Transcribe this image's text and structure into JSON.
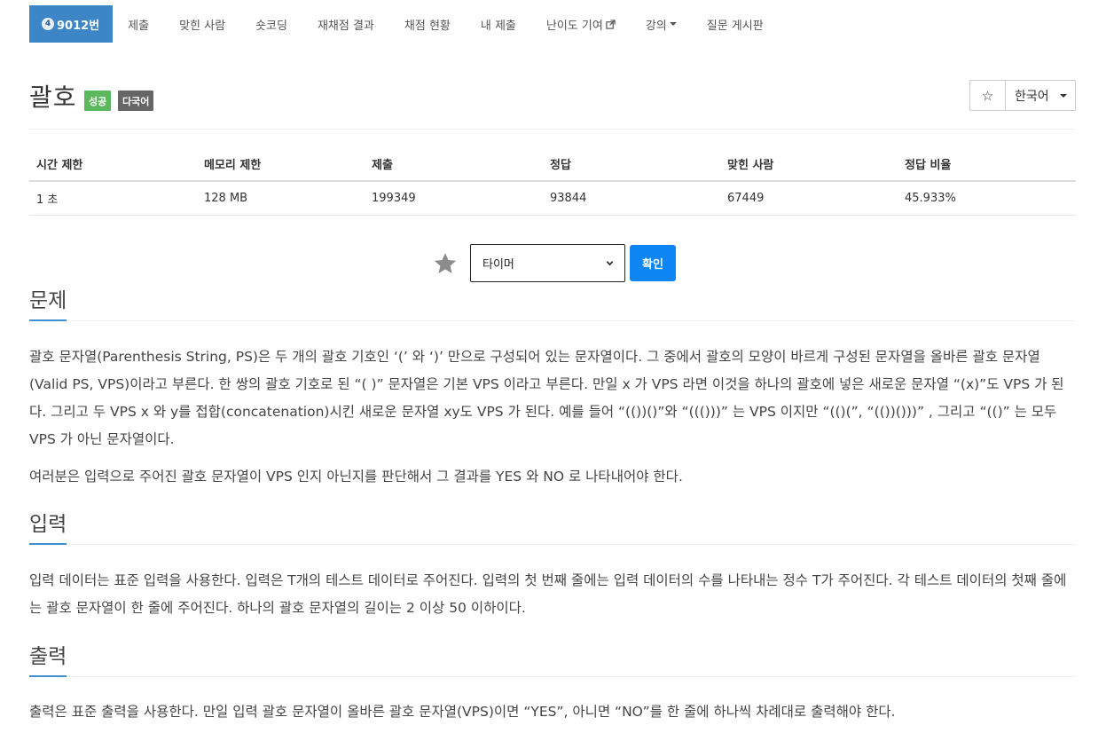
{
  "nav": {
    "problem_badge": "4",
    "problem_num": "9012번",
    "items": [
      "제출",
      "맞힌 사람",
      "숏코딩",
      "재채점 결과",
      "채점 현황",
      "내 제출",
      "난이도 기여",
      "강의",
      "질문 게시판"
    ]
  },
  "title": "괄호",
  "labels": {
    "success": "성공",
    "lang": "다국어"
  },
  "actions": {
    "star": "☆",
    "language": "한국어"
  },
  "info": {
    "headers": [
      "시간 제한",
      "메모리 제한",
      "제출",
      "정답",
      "맞힌 사람",
      "정답 비율"
    ],
    "values": [
      "1 초",
      "128 MB",
      "199349",
      "93844",
      "67449",
      "45.933%"
    ]
  },
  "timer": {
    "selected": "타이머",
    "confirm": "확인"
  },
  "sections": {
    "problem": {
      "title": "문제",
      "p1": "괄호 문자열(Parenthesis String, PS)은 두 개의 괄호 기호인 ‘(’ 와 ‘)’ 만으로 구성되어 있는 문자열이다. 그 중에서 괄호의 모양이 바르게 구성된 문자열을 올바른 괄호 문자열(Valid PS, VPS)이라고 부른다. 한 쌍의 괄호 기호로 된 “( )” 문자열은 기본 VPS 이라고 부른다. 만일 x 가 VPS 라면 이것을 하나의 괄호에 넣은 새로운 문자열 “(x)”도 VPS 가 된다. 그리고 두 VPS x 와 y를 접합(concatenation)시킨 새로운 문자열 xy도 VPS 가 된다. 예를 들어 “(())()”와 “((()))” 는 VPS 이지만 “(()(”, “(())()))” , 그리고 “(()” 는 모두 VPS 가 아닌 문자열이다.",
      "p2": "여러분은 입력으로 주어진 괄호 문자열이 VPS 인지 아닌지를 판단해서 그 결과를 YES 와 NO 로 나타내어야 한다."
    },
    "input": {
      "title": "입력",
      "p1": "입력 데이터는 표준 입력을 사용한다. 입력은 T개의 테스트 데이터로 주어진다. 입력의 첫 번째 줄에는 입력 데이터의 수를 나타내는 정수 T가 주어진다. 각 테스트 데이터의 첫째 줄에는 괄호 문자열이 한 줄에 주어진다. 하나의 괄호 문자열의 길이는 2 이상 50 이하이다."
    },
    "output": {
      "title": "출력",
      "p1": "출력은 표준 출력을 사용한다. 만일 입력 괄호 문자열이 올바른 괄호 문자열(VPS)이면 “YES”, 아니면 “NO”를 한 줄에 하나씩 차례대로 출력해야 한다."
    }
  }
}
